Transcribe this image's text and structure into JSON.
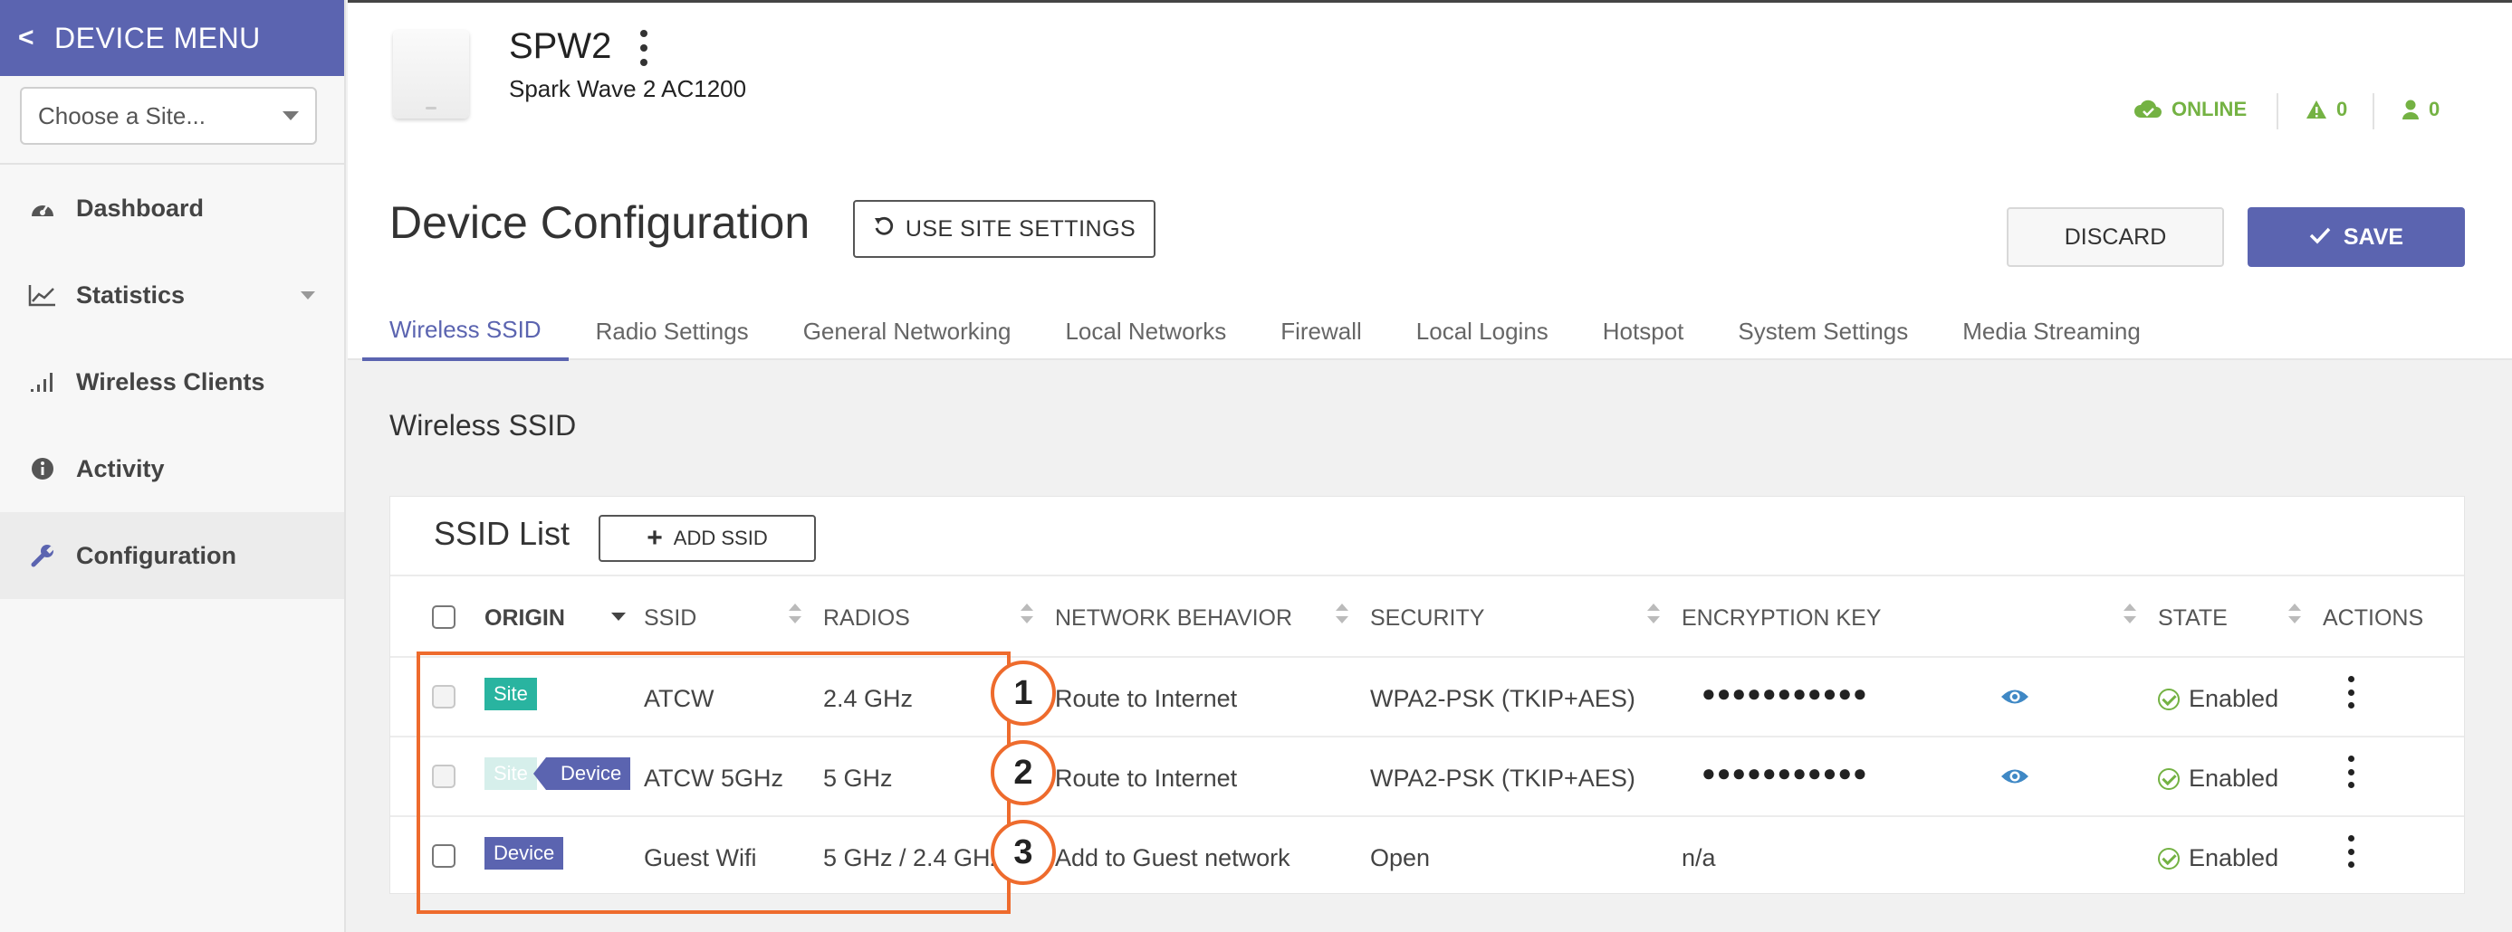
{
  "sidebar": {
    "title": "DEVICE MENU",
    "site_placeholder": "Choose a Site...",
    "items": [
      {
        "label": "Dashboard",
        "icon": "dashboard-icon"
      },
      {
        "label": "Statistics",
        "icon": "line-chart-icon"
      },
      {
        "label": "Wireless Clients",
        "icon": "signal-bars-icon"
      },
      {
        "label": "Activity",
        "icon": "info-icon"
      },
      {
        "label": "Configuration",
        "icon": "wrench-icon",
        "active": true
      }
    ]
  },
  "header": {
    "device_name": "SPW2",
    "device_model": "Spark Wave 2 AC1200",
    "status_online": "ONLINE",
    "alerts_count": "0",
    "users_count": "0"
  },
  "page": {
    "title": "Device Configuration",
    "use_site_settings": "USE SITE SETTINGS",
    "discard": "DISCARD",
    "save": "SAVE"
  },
  "tabs": [
    {
      "label": "Wireless SSID",
      "active": true
    },
    {
      "label": "Radio Settings"
    },
    {
      "label": "General Networking"
    },
    {
      "label": "Local Networks"
    },
    {
      "label": "Firewall"
    },
    {
      "label": "Local Logins"
    },
    {
      "label": "Hotspot"
    },
    {
      "label": "System Settings"
    },
    {
      "label": "Media Streaming"
    }
  ],
  "section_title": "Wireless SSID",
  "ssid_list": {
    "title": "SSID List",
    "add_button": "ADD SSID",
    "columns": [
      "ORIGIN",
      "SSID",
      "RADIOS",
      "NETWORK BEHAVIOR",
      "SECURITY",
      "ENCRYPTION KEY",
      "STATE",
      "ACTIONS"
    ],
    "rows": [
      {
        "origin": [
          "Site"
        ],
        "ssid": "ATCW",
        "radios": "2.4 GHz",
        "behavior": "Route to Internet",
        "security": "WPA2-PSK (TKIP+AES)",
        "key": "●●●●●●●●●●●",
        "state": "Enabled"
      },
      {
        "origin": [
          "Site",
          "Device"
        ],
        "ssid": "ATCW 5GHz",
        "radios": "5 GHz",
        "behavior": "Route to Internet",
        "security": "WPA2-PSK (TKIP+AES)",
        "key": "●●●●●●●●●●●",
        "state": "Enabled"
      },
      {
        "origin": [
          "Device"
        ],
        "ssid": "Guest Wifi",
        "radios": "5 GHz / 2.4 GHz",
        "behavior": "Add to Guest network",
        "security": "Open",
        "key": "n/a",
        "state": "Enabled"
      }
    ]
  },
  "annotations": [
    "1",
    "2",
    "3"
  ],
  "colors": {
    "accent": "#5b64b0",
    "site_badge": "#29b4a0",
    "online": "#74b243",
    "annotation": "#ee6b2d"
  }
}
